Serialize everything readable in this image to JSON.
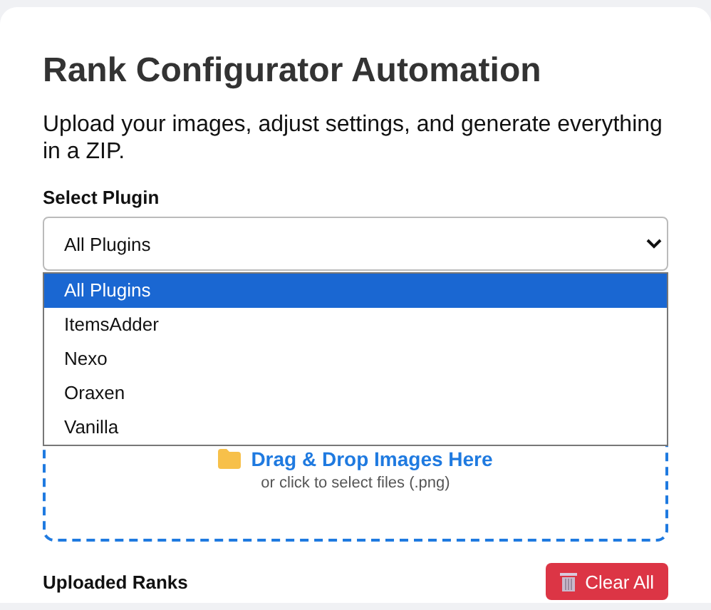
{
  "title": "Rank Configurator Automation",
  "subtitle": "Upload your images, adjust settings, and generate everything in a ZIP.",
  "plugin_select": {
    "label": "Select Plugin",
    "value": "All Plugins",
    "expanded": true,
    "options": [
      {
        "label": "All Plugins",
        "selected": true
      },
      {
        "label": "ItemsAdder",
        "selected": false
      },
      {
        "label": "Nexo",
        "selected": false
      },
      {
        "label": "Oraxen",
        "selected": false
      },
      {
        "label": "Vanilla",
        "selected": false
      }
    ]
  },
  "dropzone": {
    "title": "Drag & Drop Images Here",
    "hint": "or click to select files (.png)"
  },
  "uploaded": {
    "heading": "Uploaded Ranks",
    "clear_button": "Clear All"
  }
}
